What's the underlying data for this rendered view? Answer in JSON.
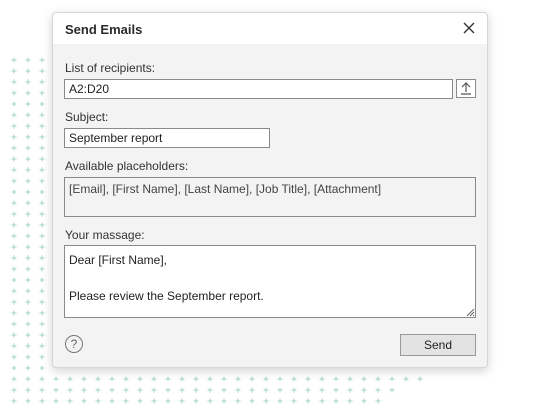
{
  "dialog": {
    "title": "Send Emails",
    "close_icon": "close-icon"
  },
  "recipients": {
    "label": "List of recipients:",
    "value": "A2:D20",
    "upload_icon": "upload-icon"
  },
  "subject": {
    "label": "Subject:",
    "value": "September report"
  },
  "placeholders": {
    "label": "Available placeholders:",
    "text": "[Email], [First Name], [Last Name], [Job Title], [Attachment]"
  },
  "message": {
    "label": "Your massage:",
    "line1": "Dear [First Name],",
    "line2": "Please review the September report."
  },
  "footer": {
    "help_symbol": "?",
    "send_label": "Send"
  },
  "colors": {
    "dialog_bg": "#f3f3f3",
    "decor_plus": "#9fd3c7"
  }
}
